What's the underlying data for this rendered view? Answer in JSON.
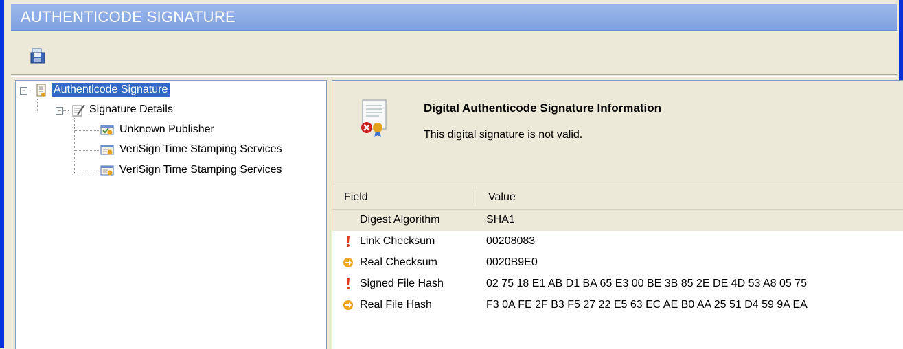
{
  "window": {
    "title": "AUTHENTICODE SIGNATURE"
  },
  "toolbar": {
    "save_icon": "save-icon"
  },
  "tree": {
    "root": {
      "label": "Authenticode Signature",
      "icon": "certificate-document-icon",
      "expanded": true
    },
    "details": {
      "label": "Signature Details",
      "icon": "signature-details-icon",
      "expanded": true
    },
    "children": [
      {
        "label": "Unknown Publisher",
        "icon": "certificate-check-icon"
      },
      {
        "label": "VeriSign Time Stamping Services",
        "icon": "certificate-icon"
      },
      {
        "label": "VeriSign Time Stamping Services",
        "icon": "certificate-icon"
      }
    ]
  },
  "info": {
    "title": "Digital Authenticode Signature Information",
    "subtitle": "This digital signature is not valid.",
    "icon": "invalid-certificate-icon"
  },
  "list": {
    "headers": {
      "field": "Field",
      "value": "Value"
    },
    "rows": [
      {
        "field": "Digest Algorithm",
        "value": "SHA1",
        "icon": ""
      },
      {
        "field": "Link Checksum",
        "value": "00208083",
        "icon": "warning-exclamation-icon"
      },
      {
        "field": "Real Checksum",
        "value": "0020B9E0",
        "icon": "arrow-circle-icon"
      },
      {
        "field": "Signed File Hash",
        "value": "02 75 18 E1 AB D1 BA 65 E3 00 BE 3B 85 2E DE 4D 53 A8 05 75",
        "icon": "warning-exclamation-icon"
      },
      {
        "field": "Real File Hash",
        "value": "F3 0A FE 2F B3 F5 27 22 E5 63 EC AE B0 AA 25 51 D4 59 9A EA",
        "icon": "arrow-circle-icon"
      }
    ]
  },
  "colors": {
    "titlebar": "#7ea0e0",
    "selection": "#316ac5",
    "frame": "#0831d9"
  }
}
